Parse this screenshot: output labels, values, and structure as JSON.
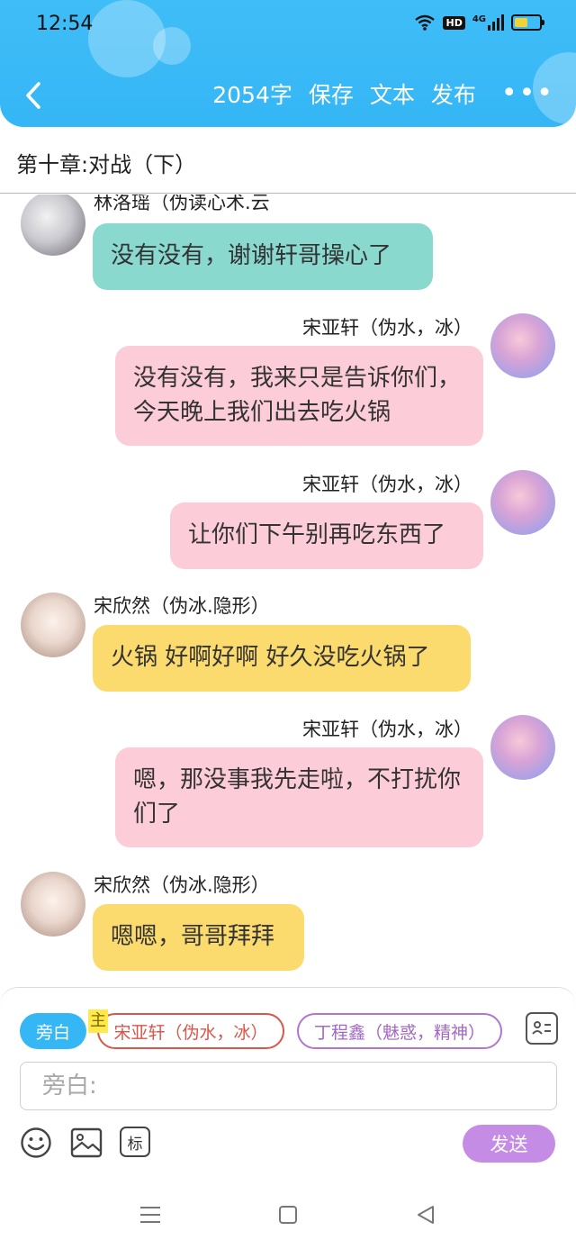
{
  "status_bar": {
    "time": "12:54",
    "hd": "HD",
    "network": "4G"
  },
  "header": {
    "word_count": "2054字",
    "save_label": "保存",
    "text_label": "文本",
    "publish_label": "发布",
    "more_label": "•••"
  },
  "chapter": {
    "title": "第十章:对战（下）"
  },
  "messages": [
    {
      "sender": "林洛瑶（伪读心术.云",
      "text": "没有没有，谢谢轩哥操心了"
    },
    {
      "sender": "宋亚轩（伪水，冰）",
      "text": "没有没有，我来只是告诉你们，今天晚上我们出去吃火锅"
    },
    {
      "sender": "宋亚轩（伪水，冰）",
      "text": "让你们下午别再吃东西了"
    },
    {
      "sender": "宋欣然（伪冰.隐形）",
      "text": "火锅 好啊好啊 好久没吃火锅了"
    },
    {
      "sender": "宋亚轩（伪水，冰）",
      "text": "嗯，那没事我先走啦，不打扰你们了"
    },
    {
      "sender": "宋欣然（伪冰.隐形）",
      "text": "嗯嗯，哥哥拜拜"
    }
  ],
  "compose": {
    "roles": [
      "旁白",
      "宋亚轩（伪水，冰）",
      "丁程鑫（魅惑，精神）"
    ],
    "main_tag": "主",
    "input_placeholder": "旁白:",
    "mark_label": "标",
    "send_label": "发送"
  },
  "colors": {
    "header": "#35b6f5",
    "bubble_teal": "#8ad9cf",
    "bubble_pink": "#fcccd9",
    "bubble_yellow": "#fcdb6e",
    "send_button": "#c58ce6"
  }
}
